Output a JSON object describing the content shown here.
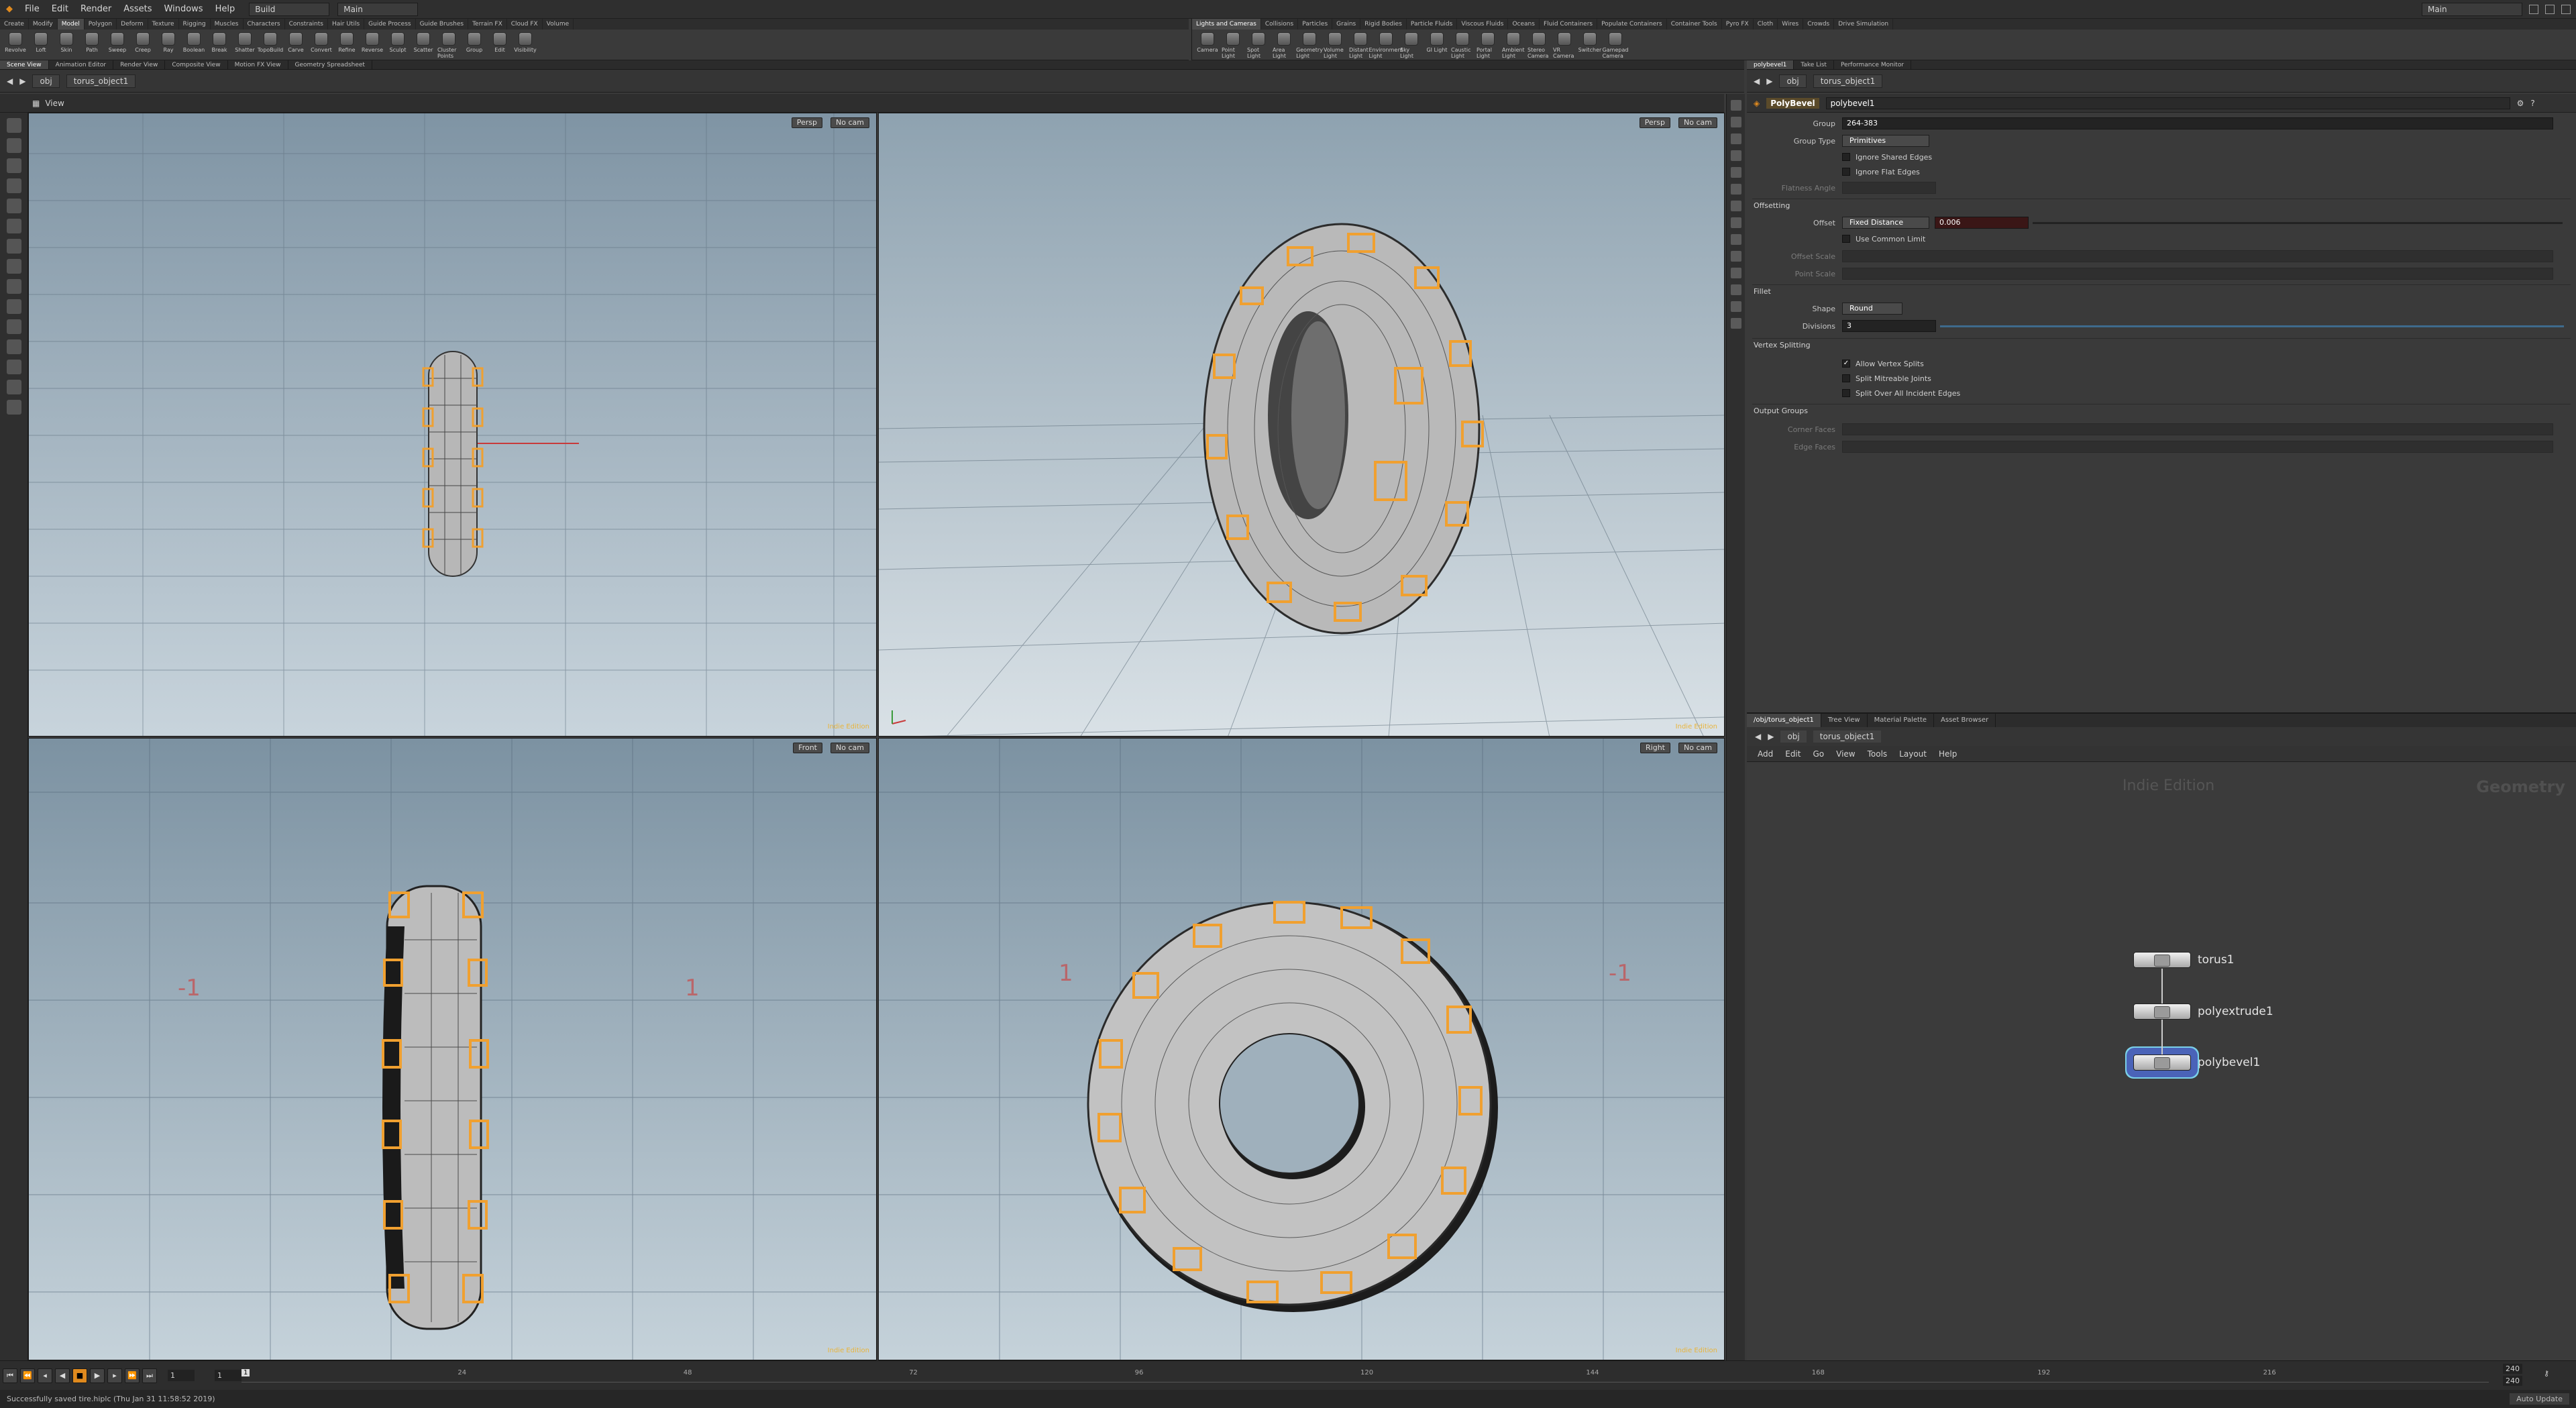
{
  "menu": {
    "items": [
      "File",
      "Edit",
      "Render",
      "Assets",
      "Windows",
      "Help"
    ],
    "desktop": "Build",
    "context": "Main",
    "right_label": "Main"
  },
  "shelf": {
    "left_tabs": [
      "Create",
      "Modify",
      "Model",
      "Polygon",
      "Deform",
      "Texture",
      "Rigging",
      "Muscles",
      "Characters",
      "Constraints",
      "Hair Utils",
      "Guide Process",
      "Guide Brushes",
      "Terrain FX",
      "Cloud FX",
      "Volume"
    ],
    "left_active": "Model",
    "left_tools": [
      "Revolve",
      "Loft",
      "Skin",
      "Path",
      "Sweep",
      "Creep",
      "Ray",
      "Boolean",
      "Break",
      "Shatter",
      "TopoBuild",
      "Carve",
      "Convert",
      "Refine",
      "Reverse",
      "Sculpt",
      "Scatter",
      "Cluster Points",
      "Group",
      "Edit",
      "Visibility"
    ],
    "right_tabs": [
      "Lights and Cameras",
      "Collisions",
      "Particles",
      "Grains",
      "Rigid Bodies",
      "Particle Fluids",
      "Viscous Fluids",
      "Oceans",
      "Fluid Containers",
      "Populate Containers",
      "Container Tools",
      "Pyro FX",
      "Cloth",
      "Wires",
      "Crowds",
      "Drive Simulation"
    ],
    "right_active": "Lights and Cameras",
    "right_tools": [
      "Camera",
      "Point Light",
      "Spot Light",
      "Area Light",
      "Geometry Light",
      "Volume Light",
      "Distant Light",
      "Environment Light",
      "Sky Light",
      "GI Light",
      "Caustic Light",
      "Portal Light",
      "Ambient Light",
      "Stereo Camera",
      "VR Camera",
      "Switcher",
      "Gamepad Camera"
    ]
  },
  "pane_tabs": {
    "left": [
      "Scene View",
      "Animation Editor",
      "Render View",
      "Composite View",
      "Motion FX View",
      "Geometry Spreadsheet"
    ],
    "left_active": "Scene View",
    "right": [
      "polybevel1",
      "Take List",
      "Performance Monitor"
    ],
    "right_active": "polybevel1"
  },
  "path": {
    "root": "obj",
    "node": "torus_object1"
  },
  "viewport": {
    "title": "View",
    "panes": [
      {
        "view": "Persp",
        "cam": "No cam"
      },
      {
        "view": "Persp",
        "cam": "No cam"
      },
      {
        "view": "Front",
        "cam": "No cam"
      },
      {
        "view": "Right",
        "cam": "No cam"
      }
    ],
    "edition": "Indie Edition",
    "tick_labels": [
      "-1",
      "1",
      "1",
      "-1"
    ]
  },
  "params": {
    "node_type": "PolyBevel",
    "node_name": "polybevel1",
    "group_label": "Group",
    "group_value": "264-383",
    "group_type_label": "Group Type",
    "group_type_value": "Primitives",
    "ignore_shared": "Ignore Shared Edges",
    "ignore_flat": "Ignore Flat Edges",
    "flatness_label": "Flatness Angle",
    "offsetting_section": "Offsetting",
    "offset_label": "Offset",
    "offset_mode": "Fixed Distance",
    "offset_value": "0.006",
    "use_common_limit": "Use Common Limit",
    "offset_scale_label": "Offset Scale",
    "point_scale_label": "Point Scale",
    "fillet_section": "Fillet",
    "shape_label": "Shape",
    "shape_value": "Round",
    "divisions_label": "Divisions",
    "divisions_value": "3",
    "vertex_section": "Vertex Splitting",
    "allow_vertex": "Allow Vertex Splits",
    "split_mitre": "Split Mitreable Joints",
    "split_all": "Split Over All Incident Edges",
    "output_section": "Output Groups",
    "corner_faces": "Corner Faces",
    "edge_faces": "Edge Faces"
  },
  "network": {
    "tabs": [
      "/obj/torus_object1",
      "Tree View",
      "Material Palette",
      "Asset Browser"
    ],
    "active_tab": "/obj/torus_object1",
    "menu": [
      "Add",
      "Edit",
      "Go",
      "View",
      "Tools",
      "Layout",
      "Help"
    ],
    "watermark": "Indie Edition",
    "context": "Geometry",
    "nodes": [
      "torus1",
      "polyextrude1",
      "polybevel1"
    ]
  },
  "timeline": {
    "frame": "1",
    "start": "1",
    "end_a": "240",
    "end_b": "240",
    "ticks": [
      "24",
      "48",
      "72",
      "96",
      "120",
      "144",
      "168",
      "192",
      "216"
    ],
    "marker": "1"
  },
  "status": {
    "message": "Successfully saved tire.hiplc (Thu Jan 31 11:58:52 2019)",
    "update_mode": "Auto Update"
  },
  "colors": {
    "accent": "#e08a1e",
    "selection": "#f0a030"
  }
}
